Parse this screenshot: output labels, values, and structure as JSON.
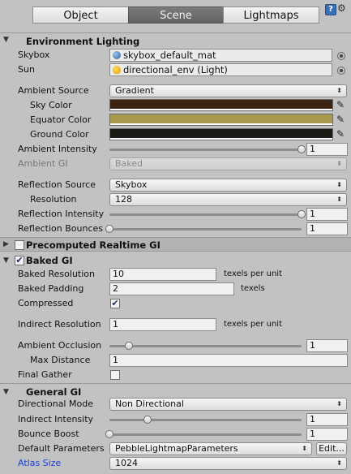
{
  "tabs": [
    {
      "label": "Object"
    },
    {
      "label": "Scene"
    },
    {
      "label": "Lightmaps"
    }
  ],
  "toolbar": {
    "help_glyph": "?",
    "settings_icon": "gear-icon",
    "help_icon": "help-icon"
  },
  "environment_lighting": {
    "title": "Environment Lighting",
    "skybox": {
      "label": "Skybox",
      "value": "skybox_default_mat"
    },
    "sun": {
      "label": "Sun",
      "value": "directional_env (Light)"
    },
    "ambient_source": {
      "label": "Ambient Source",
      "value": "Gradient"
    },
    "sky_color": {
      "label": "Sky Color",
      "color": "#3c2412"
    },
    "equator_color": {
      "label": "Equator Color",
      "color": "#a9994c"
    },
    "ground_color": {
      "label": "Ground Color",
      "color": "#1c1c16"
    },
    "ambient_intensity": {
      "label": "Ambient Intensity",
      "value": "1",
      "fraction": 1.0
    },
    "ambient_gi": {
      "label": "Ambient GI",
      "value": "Baked"
    },
    "reflection_source": {
      "label": "Reflection Source",
      "value": "Skybox"
    },
    "resolution": {
      "label": "Resolution",
      "value": "128"
    },
    "reflection_intensity": {
      "label": "Reflection Intensity",
      "value": "1",
      "fraction": 1.0
    },
    "reflection_bounces": {
      "label": "Reflection Bounces",
      "value": "1",
      "fraction": 0.0
    }
  },
  "precomputed_gi": {
    "title": "Precomputed Realtime GI",
    "enabled": false
  },
  "baked_gi": {
    "title": "Baked GI",
    "enabled": true,
    "baked_resolution": {
      "label": "Baked Resolution",
      "value": "10",
      "unit": "texels per unit"
    },
    "baked_padding": {
      "label": "Baked Padding",
      "value": "2",
      "unit": "texels"
    },
    "compressed": {
      "label": "Compressed",
      "checked": true
    },
    "indirect_resolution": {
      "label": "Indirect Resolution",
      "value": "1",
      "unit": "texels per unit"
    },
    "ambient_occlusion": {
      "label": "Ambient Occlusion",
      "value": "1",
      "fraction": 0.1
    },
    "max_distance": {
      "label": "Max Distance",
      "value": "1"
    },
    "final_gather": {
      "label": "Final Gather",
      "checked": false
    }
  },
  "general_gi": {
    "title": "General GI",
    "directional_mode": {
      "label": "Directional Mode",
      "value": "Non Directional"
    },
    "indirect_intensity": {
      "label": "Indirect Intensity",
      "value": "1",
      "fraction": 0.2
    },
    "bounce_boost": {
      "label": "Bounce Boost",
      "value": "1",
      "fraction": 0.0
    },
    "default_parameters": {
      "label": "Default Parameters",
      "value": "PebbleLightmapParameters",
      "edit_label": "Edit..."
    },
    "atlas_size": {
      "label": "Atlas Size",
      "value": "1024"
    }
  },
  "glyphs": {
    "checkmark": "✔",
    "dropdown_arrow": "▲▼",
    "eyedropper": "✎",
    "fold_open": "▼",
    "fold_closed": "▶"
  }
}
